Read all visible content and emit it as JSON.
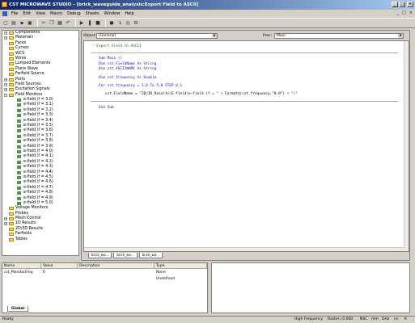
{
  "window": {
    "title": "CST MICROWAVE STUDIO - [brick_waveguide_analysis:Export Field to ASCII]",
    "controls": {
      "minimize": "_",
      "maximize": "□",
      "close": "×"
    }
  },
  "menu": {
    "items": [
      "File",
      "Edit",
      "View",
      "Macro",
      "Debug",
      "Sheets",
      "Window",
      "Help"
    ],
    "mdi_controls": [
      "_",
      "□",
      "×"
    ]
  },
  "toolbar": {
    "icons": [
      "new-icon",
      "open-icon",
      "save-icon",
      "print-icon",
      "cut-icon",
      "copy-icon",
      "paste-icon",
      "undo-icon",
      "run-icon",
      "pause-icon",
      "stop-icon",
      "breakpoint-icon",
      "step-icon",
      "watch-icon",
      "browse-icon"
    ]
  },
  "tree": {
    "items": [
      {
        "label": "Components",
        "type": "folder",
        "expander": "+"
      },
      {
        "label": "Materials",
        "type": "folder",
        "expander": "+"
      },
      {
        "label": "Faces",
        "type": "folder",
        "expander": ""
      },
      {
        "label": "Curves",
        "type": "folder",
        "expander": ""
      },
      {
        "label": "WCS",
        "type": "folder",
        "expander": ""
      },
      {
        "label": "Wires",
        "type": "folder",
        "expander": ""
      },
      {
        "label": "Lumped Elements",
        "type": "folder",
        "expander": ""
      },
      {
        "label": "Plane Wave",
        "type": "folder",
        "expander": ""
      },
      {
        "label": "Farfield Source",
        "type": "folder",
        "expander": ""
      },
      {
        "label": "Ports",
        "type": "folder",
        "expander": "+"
      },
      {
        "label": "Field Sources",
        "type": "folder",
        "expander": "+"
      },
      {
        "label": "Excitation Signals",
        "type": "folder",
        "expander": "+"
      },
      {
        "label": "Field Monitors",
        "type": "folder",
        "expander": "−"
      },
      {
        "label": "e-field (f = 3.0)",
        "type": "field",
        "expander": ""
      },
      {
        "label": "e-field (f = 3.1)",
        "type": "field",
        "expander": ""
      },
      {
        "label": "e-field (f = 3.2)",
        "type": "field",
        "expander": ""
      },
      {
        "label": "e-field (f = 3.3)",
        "type": "field",
        "expander": ""
      },
      {
        "label": "e-field (f = 3.4)",
        "type": "field",
        "expander": ""
      },
      {
        "label": "e-field (f = 3.5)",
        "type": "field",
        "expander": ""
      },
      {
        "label": "e-field (f = 3.6)",
        "type": "field",
        "expander": ""
      },
      {
        "label": "e-field (f = 3.7)",
        "type": "field",
        "expander": ""
      },
      {
        "label": "e-field (f = 3.8)",
        "type": "field",
        "expander": ""
      },
      {
        "label": "e-field (f = 3.9)",
        "type": "field",
        "expander": ""
      },
      {
        "label": "e-field (f = 4.0)",
        "type": "field",
        "expander": ""
      },
      {
        "label": "e-field (f = 4.1)",
        "type": "field",
        "expander": ""
      },
      {
        "label": "e-field (f = 4.2)",
        "type": "field",
        "expander": ""
      },
      {
        "label": "e-field (f = 4.3)",
        "type": "field",
        "expander": ""
      },
      {
        "label": "e-field (f = 4.4)",
        "type": "field",
        "expander": ""
      },
      {
        "label": "e-field (f = 4.5)",
        "type": "field",
        "expander": ""
      },
      {
        "label": "e-field (f = 4.6)",
        "type": "field",
        "expander": ""
      },
      {
        "label": "e-field (f = 4.7)",
        "type": "field",
        "expander": ""
      },
      {
        "label": "e-field (f = 4.8)",
        "type": "field",
        "expander": ""
      },
      {
        "label": "e-field (f = 4.9)",
        "type": "field",
        "expander": ""
      },
      {
        "label": "e-field (f = 5.0)",
        "type": "field",
        "expander": ""
      },
      {
        "label": "Voltage Monitors",
        "type": "folder",
        "expander": ""
      },
      {
        "label": "Probes",
        "type": "folder",
        "expander": ""
      },
      {
        "label": "Mesh Control",
        "type": "folder",
        "expander": "+"
      },
      {
        "label": "1D Results",
        "type": "folder",
        "expander": "+"
      },
      {
        "label": "2D/3D Results",
        "type": "folder",
        "expander": ""
      },
      {
        "label": "Farfields",
        "type": "folder",
        "expander": ""
      },
      {
        "label": "Tables",
        "type": "folder",
        "expander": ""
      }
    ]
  },
  "editor": {
    "object_label": "Object:",
    "object_value": "(General)",
    "proc_label": "Proc:",
    "proc_value": "Main",
    "code": {
      "comment": "' Export Field to ASCII",
      "sub_main": "Sub Main ()",
      "dim1": "Dim cst_FieldName As String",
      "dim2": "Dim cst_ASCIINAME As String",
      "dim3": "Dim cst_frequency As Double",
      "for_line": "For cst_frequency = 3.0 To 5.0 STEP 0.1",
      "body": "cst_FieldName = \"2D/3D Results\\E-field\\e-field (f = \" + Format$(cst_frequency,\"0.0\") + \")\"",
      "end_sub": "End Sub"
    },
    "doc_tabs": [
      "brick_wa...",
      "brick_wa...",
      "brick_wa..."
    ]
  },
  "watch_grid": {
    "columns": [
      "Name",
      "Value",
      "Description",
      "Type"
    ],
    "rows": [
      [
        "cst_MonitorFreq",
        "0",
        "",
        "None"
      ],
      [
        "",
        "",
        "",
        "Undefined"
      ]
    ],
    "tab": "Global"
  },
  "status": {
    "left": "Ready",
    "mode": "High Frequency",
    "raster": "Raster=0.000",
    "units": [
      "NSC",
      "mm",
      "GHz",
      "ns",
      "K"
    ]
  }
}
